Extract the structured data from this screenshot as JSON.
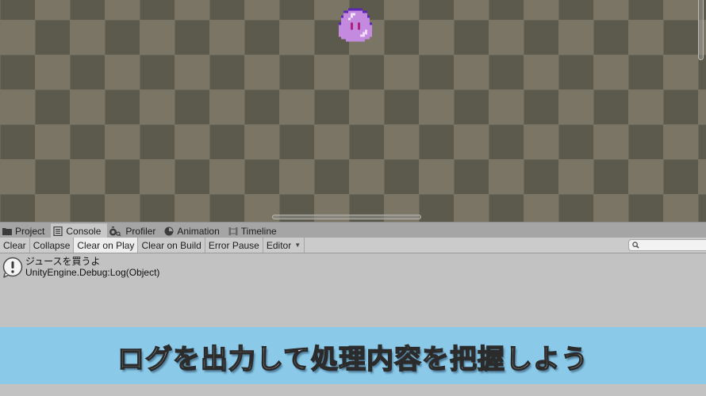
{
  "scene": {
    "sprite": "purple-slime",
    "colors": {
      "checker_light": "#7a7565",
      "checker_dark": "#5b5a4c"
    }
  },
  "tabs": [
    {
      "label": "Project",
      "icon": "folder-icon",
      "active": false
    },
    {
      "label": "Console",
      "icon": "console-icon",
      "active": true
    },
    {
      "label": "Profiler",
      "icon": "profiler-icon",
      "active": false
    },
    {
      "label": "Animation",
      "icon": "animation-icon",
      "active": false
    },
    {
      "label": "Timeline",
      "icon": "timeline-icon",
      "active": false
    }
  ],
  "toolbar": {
    "clear": "Clear",
    "collapse": "Collapse",
    "clear_on_play": "Clear on Play",
    "clear_on_build": "Clear on Build",
    "error_pause": "Error Pause",
    "editor": "Editor",
    "editor_caret": "▼",
    "search_placeholder": "",
    "search_value": ""
  },
  "console": {
    "entries": [
      {
        "type": "info",
        "message": "ジュースを買うよ",
        "trace": "UnityEngine.Debug:Log(Object)"
      }
    ]
  },
  "banner": {
    "text": "ログを出力して処理内容を把握しよう",
    "color": "#8bc9e8"
  }
}
